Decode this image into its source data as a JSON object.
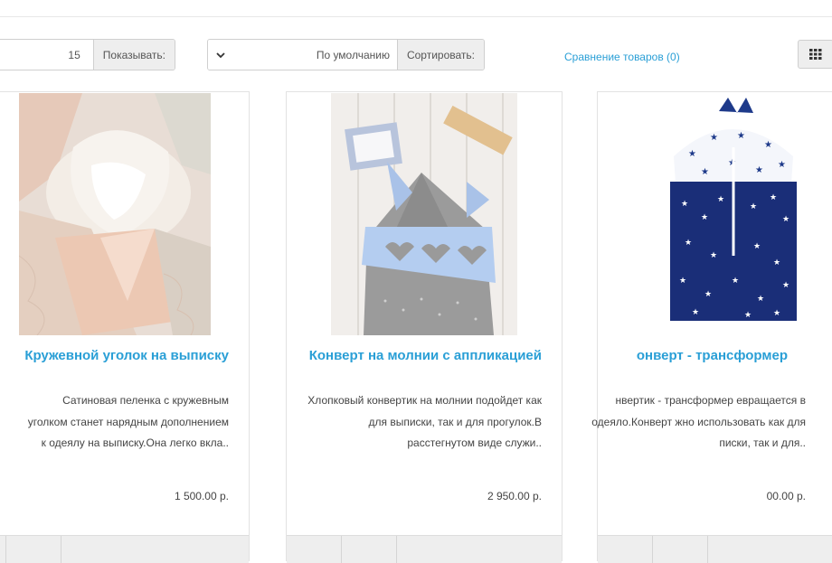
{
  "toolbar": {
    "view_grid_icon": "grid-icon",
    "compare_label": "Сравнение товаров (0)",
    "sort_label": "Сортировать:",
    "sort_value": "По умолчанию",
    "limit_label": "Показывать:",
    "limit_value": "15"
  },
  "colors": {
    "link": "#2a9fd6",
    "addon_bg": "#eeeeee",
    "border": "#cfcfcf"
  },
  "products": [
    {
      "title": "Кружевной уголок на выписку",
      "description": "Сатиновая пеленка с кружевным уголком станет нарядным дополнением к одеялу на выписку.Она легко вкла..",
      "price": "1 500.00 р."
    },
    {
      "title": "Конверт на молнии с аппликацией",
      "description": "Хлопковый конвертик на молнии подойдет как для выписки, так и для прогулок.В расстегнутом виде служи..",
      "price": "2 950.00 р."
    },
    {
      "title": "онверт - трансформер",
      "description": "нвертик - трансформер евращается в одеяло.Конверт жно использовать как для писки, так и для..",
      "price": "00.00 р."
    }
  ]
}
